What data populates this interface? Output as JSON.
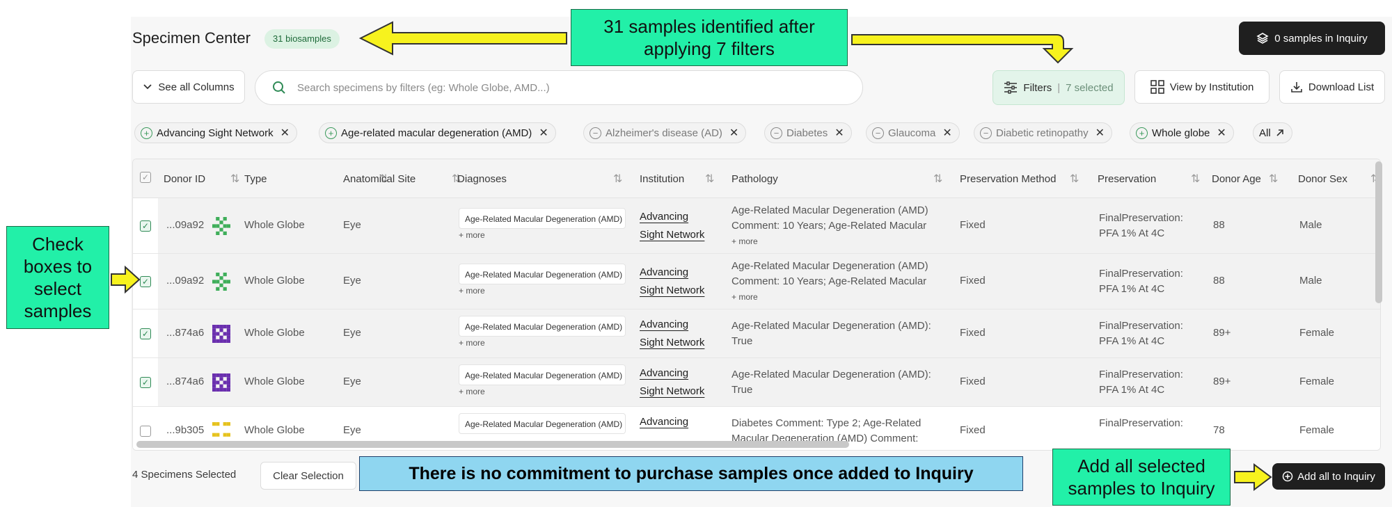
{
  "header": {
    "title": "Specimen Center",
    "biosample_badge": "31 biosamples",
    "inquiry_button": "0 samples in Inquiry"
  },
  "toolbar": {
    "columns_button": "See all Columns",
    "search_placeholder": "Search specimens by filters (eg: Whole Globe, AMD...)",
    "filters_label": "Filters",
    "filters_selected": "7 selected",
    "institution_button": "View by Institution",
    "download_button": "Download List"
  },
  "chips": [
    {
      "label": "Advancing Sight Network",
      "mode": "include"
    },
    {
      "label": "Age-related macular degeneration (AMD)",
      "mode": "include"
    },
    {
      "label": "Alzheimer's disease (AD)",
      "mode": "exclude"
    },
    {
      "label": "Diabetes",
      "mode": "exclude"
    },
    {
      "label": "Glaucoma",
      "mode": "exclude"
    },
    {
      "label": "Diabetic retinopathy",
      "mode": "exclude"
    },
    {
      "label": "Whole globe",
      "mode": "include"
    }
  ],
  "chips_all": "All",
  "table": {
    "headers": [
      "Donor ID",
      "Type",
      "Anatomical Site",
      "Diagnoses",
      "Institution",
      "Pathology",
      "Preservation Method",
      "Preservation",
      "Donor Age",
      "Donor Sex"
    ],
    "rows": [
      {
        "donor_id": "...09a92",
        "type": "Whole Globe",
        "site": "Eye",
        "diagnosis": "Age-Related Macular Degeneration (AMD)",
        "more": "+ more",
        "inst1": "Advancing",
        "inst2": "Sight Network",
        "patho1": "Age-Related Macular Degeneration (AMD)",
        "patho2": "Comment: 10 Years; Age-Related Macular",
        "patho_more": "+ more",
        "method": "Fixed",
        "pres1": "FinalPreservation:",
        "pres2": "PFA 1% At 4C",
        "age": "88",
        "sex": "Male",
        "checked": true
      },
      {
        "donor_id": "...09a92",
        "type": "Whole Globe",
        "site": "Eye",
        "diagnosis": "Age-Related Macular Degeneration (AMD)",
        "more": "+ more",
        "inst1": "Advancing",
        "inst2": "Sight Network",
        "patho1": "Age-Related Macular Degeneration (AMD)",
        "patho2": "Comment: 10 Years; Age-Related Macular",
        "patho_more": "+ more",
        "method": "Fixed",
        "pres1": "FinalPreservation:",
        "pres2": "PFA 1% At 4C",
        "age": "88",
        "sex": "Male",
        "checked": true
      },
      {
        "donor_id": "...874a6",
        "type": "Whole Globe",
        "site": "Eye",
        "diagnosis": "Age-Related Macular Degeneration (AMD)",
        "more": "+ more",
        "inst1": "Advancing",
        "inst2": "Sight Network",
        "patho1": "Age-Related Macular Degeneration (AMD):",
        "patho2": "True",
        "patho_more": "",
        "method": "Fixed",
        "pres1": "FinalPreservation:",
        "pres2": "PFA 1% At 4C",
        "age": "89+",
        "sex": "Female",
        "checked": true
      },
      {
        "donor_id": "...874a6",
        "type": "Whole Globe",
        "site": "Eye",
        "diagnosis": "Age-Related Macular Degeneration (AMD)",
        "more": "+ more",
        "inst1": "Advancing",
        "inst2": "Sight Network",
        "patho1": "Age-Related Macular Degeneration (AMD):",
        "patho2": "True",
        "patho_more": "",
        "method": "Fixed",
        "pres1": "FinalPreservation:",
        "pres2": "PFA 1% At 4C",
        "age": "89+",
        "sex": "Female",
        "checked": true
      },
      {
        "donor_id": "...9b305",
        "type": "Whole Globe",
        "site": "Eye",
        "diagnosis": "Age-Related Macular Degeneration (AMD)",
        "more": "",
        "inst1": "Advancing",
        "inst2": "",
        "patho1": "Diabetes Comment: Type 2; Age-Related",
        "patho2": "Macular Degeneration (AMD) Comment:",
        "patho_more": "",
        "method": "Fixed",
        "pres1": "FinalPreservation:",
        "pres2": "",
        "age": "78",
        "sex": "Female",
        "checked": false
      }
    ]
  },
  "footer": {
    "selected_text": "4 Specimens Selected",
    "clear_button": "Clear Selection",
    "add_all_button": "Add all to Inquiry"
  },
  "annotations": {
    "top_callout_line1": "31 samples identified after",
    "top_callout_line2": "applying 7 filters",
    "left_callout": "Check boxes to select samples",
    "bottom_note": "There is no commitment to purchase samples once added to Inquiry",
    "right_callout": "Add all selected samples to Inquiry"
  },
  "colors": {
    "callout_green": "#22f0a8",
    "note_blue": "#8fd6f0",
    "arrow_yellow": "#f7f21e",
    "accent_green": "#2e8a55",
    "dark_button": "#1f1f1f"
  },
  "icons": [
    "layers-icon",
    "chevron-down-icon",
    "search-icon",
    "sliders-icon",
    "grid-icon",
    "download-icon",
    "sort-icon",
    "external-arrow-icon",
    "plus-circle-icon"
  ]
}
